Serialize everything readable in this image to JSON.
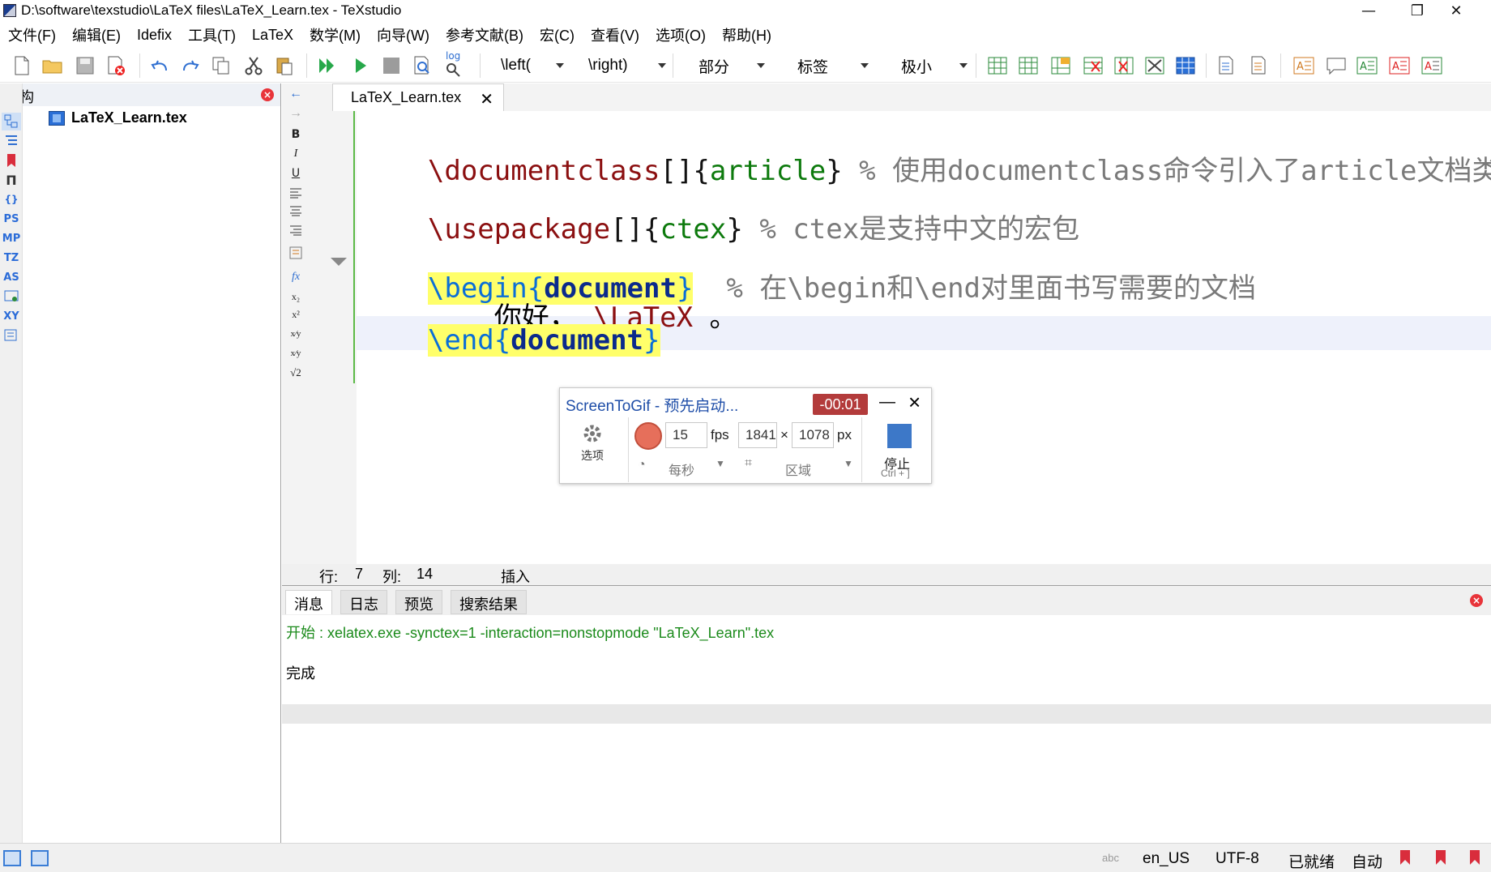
{
  "window": {
    "title": "D:\\software\\texstudio\\LaTeX files\\LaTeX_Learn.tex - TeXstudio",
    "minimize": "—",
    "restore": "❐",
    "close": "✕"
  },
  "menu": [
    "文件(F)",
    "编辑(E)",
    "Idefix",
    "工具(T)",
    "LaTeX",
    "数学(M)",
    "向导(W)",
    "参考文献(B)",
    "宏(C)",
    "查看(V)",
    "选项(O)",
    "帮助(H)"
  ],
  "toolbar": {
    "combo_left": "\\left(",
    "combo_right": "\\right)",
    "combo_section": "部分",
    "combo_label": "标签",
    "combo_size": "极小",
    "log_label": "log"
  },
  "structure": {
    "title": "结构",
    "file": "LaTeX_Learn.tex",
    "side_labels": [
      "PS",
      "MP",
      "TZ",
      "AS",
      "XY"
    ]
  },
  "editor": {
    "tab_title": "LaTeX_Learn.tex",
    "lines": {
      "l1_cmd": "\\documentclass",
      "l1_brk1": "[]{",
      "l1_arg": "article",
      "l1_brk2": "}",
      "l1_cmt": " % 使用documentclass命令引入了article文档类",
      "l3_cmd": "\\usepackage",
      "l3_brk1": "[]{",
      "l3_arg": "ctex",
      "l3_brk2": "}",
      "l3_cmt": " % ctex是支持中文的宏包",
      "l5_cmd": "\\begin",
      "l5_b1": "{",
      "l5_arg": "document",
      "l5_b2": "}",
      "l5_cmt": "  % 在\\begin和\\end对里面书写需要的文档",
      "l6_txt": "    你好， ",
      "l6_cmd": "\\LaTeX",
      "l6_tail": " 。",
      "l7_cmd": "\\end",
      "l7_b1": "{",
      "l7_arg": "document",
      "l7_b2": "}"
    },
    "status": {
      "row_label": "行:",
      "row": "7",
      "col_label": "列:",
      "col": "14",
      "mode": "插入"
    }
  },
  "messages": {
    "tabs": [
      "消息",
      "日志",
      "预览",
      "搜索结果"
    ],
    "line1": "开始 : xelatex.exe -synctex=1 -interaction=nonstopmode \"LaTeX_Learn\".tex",
    "line2": "完成"
  },
  "statusbar": {
    "language": "en_US",
    "encoding": "UTF-8",
    "state": "已就绪",
    "mode": "自动",
    "spell_icon": "abc"
  },
  "screentogif": {
    "title": "ScreenToGif - 预先启动...",
    "timer": "-00:01",
    "options": "选项",
    "fps_value": "15",
    "fps_unit": "fps",
    "per_second": "每秒",
    "width": "1841",
    "times": "×",
    "height": "1078",
    "px": "px",
    "region": "区域",
    "stop": "停止",
    "stop_shortcut": "Ctrl + ]"
  },
  "colors": {
    "command": "#8b0f10",
    "argument": "#0d7a0d",
    "comment": "#7a7a7a",
    "env_highlight": "#ffff6a",
    "accent": "#2b6cd8",
    "timer_bg": "#b33b3b"
  }
}
